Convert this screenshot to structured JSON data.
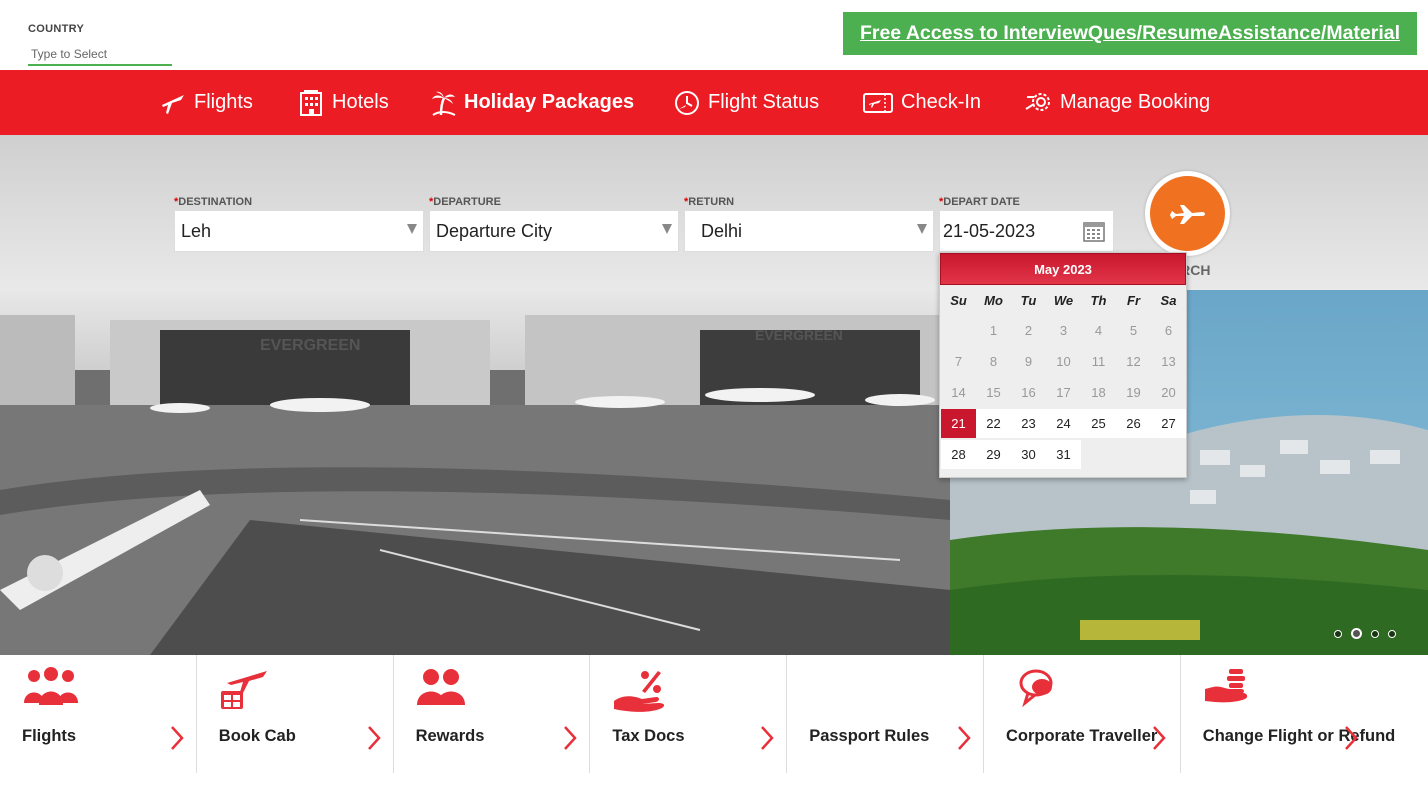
{
  "country": {
    "label": "COUNTRY",
    "placeholder": "Type to Select"
  },
  "promo": {
    "text": "Free Access to InterviewQues/ResumeAssistance/Material"
  },
  "nav": {
    "items": [
      {
        "label": "Flights",
        "icon": "plane-icon"
      },
      {
        "label": "Hotels",
        "icon": "building-icon"
      },
      {
        "label": "Holiday Packages",
        "icon": "palm-tree-icon",
        "active": true
      },
      {
        "label": "Flight Status",
        "icon": "clock-plane-icon"
      },
      {
        "label": "Check-In",
        "icon": "ticket-icon"
      },
      {
        "label": "Manage Booking",
        "icon": "gear-icon"
      }
    ]
  },
  "form": {
    "destination": {
      "label": "DESTINATION",
      "value": "Leh"
    },
    "departure": {
      "label": "DEPARTURE",
      "value": "Departure City"
    },
    "return": {
      "label": "RETURN",
      "value": "Delhi"
    },
    "depart_date": {
      "label": "DEPART DATE",
      "value": "21-05-2023"
    },
    "search_label": "ARCH"
  },
  "calendar": {
    "month_title": "May 2023",
    "weekdays": [
      "Su",
      "Mo",
      "Tu",
      "We",
      "Th",
      "Fr",
      "Sa"
    ],
    "selected_day": 21
  },
  "carousel": {
    "slides": 4,
    "active_index": 1
  },
  "tiles": [
    {
      "label": "Flights",
      "icon": "group-icon"
    },
    {
      "label": "Book Cab",
      "icon": "cab-plane-icon"
    },
    {
      "label": "Rewards",
      "icon": "users-icon"
    },
    {
      "label": "Tax Docs",
      "icon": "percent-hand-icon"
    },
    {
      "label": "Passport Rules",
      "icon": ""
    },
    {
      "label": "Corporate Traveller",
      "icon": "chat-bubble-icon"
    },
    {
      "label": "Change Flight or Refund",
      "icon": "coins-hand-icon"
    }
  ],
  "colors": {
    "brand_red": "#ec1c24",
    "promo_green": "#4caf50",
    "search_orange": "#f07221",
    "calendar_red": "#c9182d"
  }
}
